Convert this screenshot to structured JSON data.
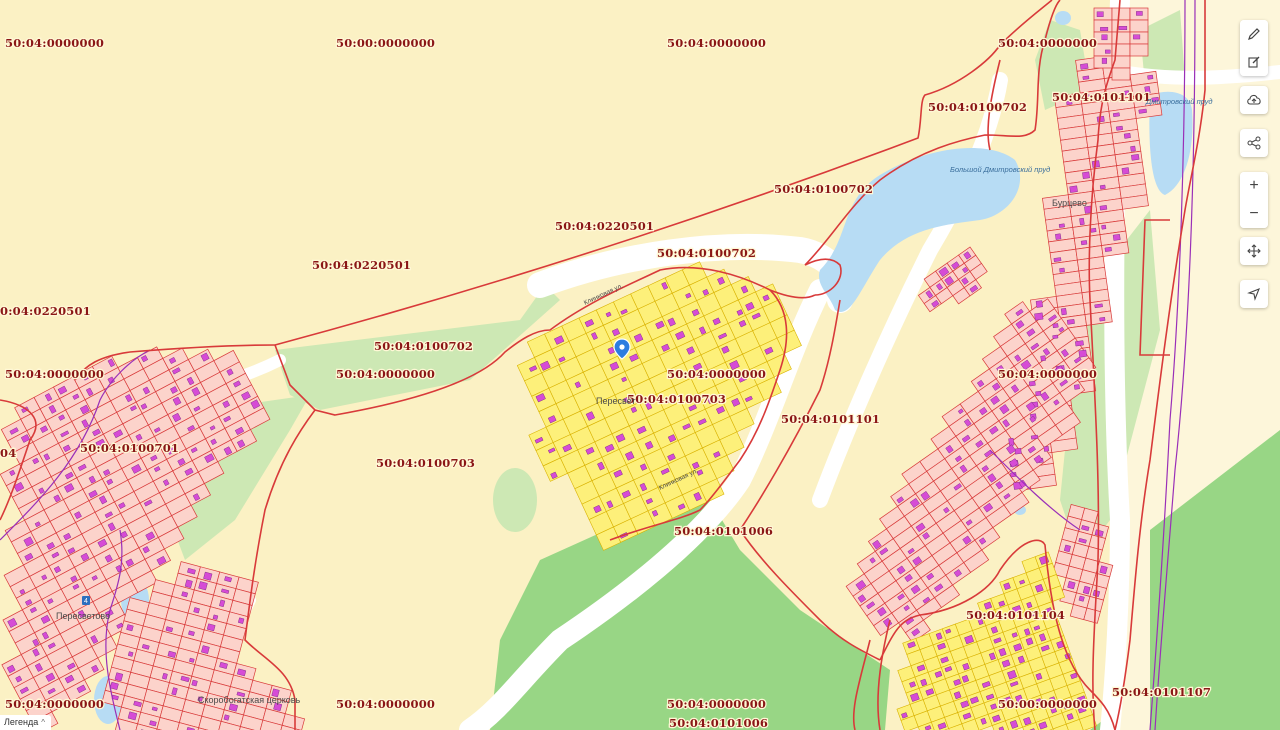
{
  "map": {
    "cadastral_labels": [
      "50:04:0000000",
      "50:00:0000000",
      "50:04:0000000",
      "50:04:0000000",
      "50:04:0100702",
      "50:04:0101101",
      "50:04:0100702",
      "50:04:0220501",
      "50:04:0100702",
      "50:04:0220501",
      "0:04:0220501",
      "50:04:0100702",
      "50:04:0000000",
      "50:04:0000000",
      "50:04:0100703",
      "50:04:0000000",
      "50:04:0000000",
      "50:04:0101101",
      "50:04:0100701",
      "04",
      "50:04:0100703",
      "50:04:0101006",
      "50:04:0101104",
      "50:04:0101107",
      "50:04:0000000",
      "50:04:0000000",
      "50:04:0000000",
      "50:00:0000000",
      "50:04:0101006"
    ],
    "place_labels": [
      "Пересветово",
      "Скоробогатская церковь",
      "Пересвет",
      "Бурцево",
      "Клинковая ул.",
      "Клинковая ул."
    ],
    "water_labels": [
      "Большой Дмитровский пруд",
      "Дмитровский пруд"
    ],
    "road_number": "4"
  },
  "toolbar": {
    "draw_icon": "pencil-icon",
    "edit_icon": "edit-icon",
    "upload_icon": "cloud-upload-icon",
    "share_icon": "share-icon",
    "zoom_in": "+",
    "zoom_out": "−",
    "move_icon": "move-icon",
    "locate_icon": "locate-icon"
  },
  "legend": {
    "label": "Легенда"
  },
  "colors": {
    "background": "#fbf1c4",
    "boundary": "#d83a3a",
    "parcel_fill": "#fcd3cb",
    "building": "#d64bd6",
    "water": "#b7dcf4",
    "forest": "#98d685",
    "meadow": "#cde8b4",
    "road": "#ffffff",
    "district_line": "#9a2fb8"
  }
}
